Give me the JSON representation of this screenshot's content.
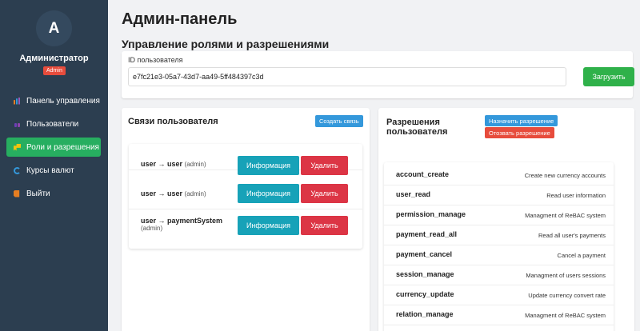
{
  "sidebar": {
    "avatar_letter": "A",
    "user_name": "Администратор",
    "role_badge": "Admin",
    "items": [
      {
        "label": "Панель управления",
        "icon": "chart-icon"
      },
      {
        "label": "Пользователи",
        "icon": "users-icon"
      },
      {
        "label": "Роли и разрешения",
        "icon": "key-icon",
        "active": true
      },
      {
        "label": "Курсы валют",
        "icon": "currency-icon"
      },
      {
        "label": "Выйти",
        "icon": "exit-icon"
      }
    ]
  },
  "main": {
    "page_title": "Админ-панель",
    "section_title": "Управление ролями и разрешениями",
    "user_id": {
      "label": "ID пользователя",
      "value": "e7fc21e3-05a7-43d7-aa49-5ff484397c3d",
      "load_button": "Загрузить"
    },
    "relations": {
      "title": "Связи пользователя",
      "create_button": "Создать связь",
      "info_button": "Информация",
      "delete_button": "Удалить",
      "rows": [
        {
          "text": "user → user",
          "type": "(admin)"
        },
        {
          "text": "user → user",
          "type": "(admin)"
        },
        {
          "text": "user → paymentSystem",
          "type": "(admin)"
        }
      ]
    },
    "permissions": {
      "title_line1": "Разрешения",
      "title_line2": "пользователя",
      "assign_button": "Назначить разрешение",
      "revoke_button": "Отозвать разрешение",
      "rows": [
        {
          "name": "account_create",
          "desc": "Create new currency accounts"
        },
        {
          "name": "user_read",
          "desc": "Read user information"
        },
        {
          "name": "permission_manage",
          "desc": "Managment of ReBAC system"
        },
        {
          "name": "payment_read_all",
          "desc": "Read all user's payments"
        },
        {
          "name": "payment_cancel",
          "desc": "Cancel a payment"
        },
        {
          "name": "session_manage",
          "desc": "Managment of users sessions"
        },
        {
          "name": "currency_update",
          "desc": "Update currency convert rate"
        },
        {
          "name": "relation_manage",
          "desc": "Managment of ReBAC system"
        }
      ]
    }
  },
  "colors": {
    "sidebar_bg": "#2c3e50",
    "active_nav": "#27ae60",
    "badge": "#e74c3c",
    "info": "#17a2b8",
    "danger": "#dc3545",
    "primary": "#3498db",
    "success": "#2fb14a"
  }
}
